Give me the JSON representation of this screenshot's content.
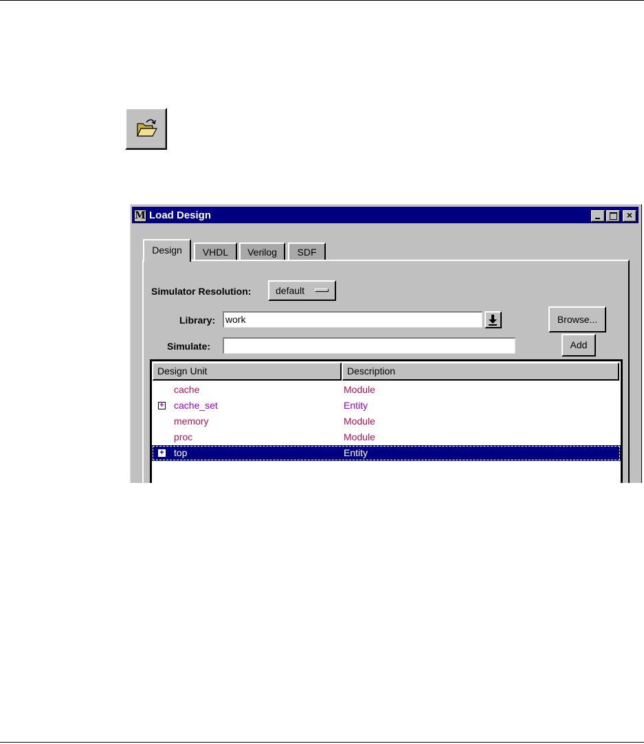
{
  "toolbar": {
    "open_icon": "open-folder-icon"
  },
  "dialog": {
    "title": "Load Design",
    "title_icon_letter": "M",
    "window_controls": [
      "minimize-icon",
      "maximize-icon",
      "close-icon"
    ],
    "tabs": [
      {
        "label": "Design",
        "active": true
      },
      {
        "label": "VHDL",
        "active": false
      },
      {
        "label": "Verilog",
        "active": false
      },
      {
        "label": "SDF",
        "active": false
      }
    ],
    "simulator_resolution": {
      "label": "Simulator Resolution:",
      "value": "default"
    },
    "library": {
      "label": "Library:",
      "value": "work"
    },
    "simulate": {
      "label": "Simulate:",
      "value": ""
    },
    "browse_label": "Browse...",
    "add_label": "Add",
    "list": {
      "columns": [
        "Design Unit",
        "Description"
      ],
      "rows": [
        {
          "name": "cache",
          "description": "Module",
          "expandable": false,
          "selected": false
        },
        {
          "name": "cache_set",
          "description": "Entity",
          "expandable": true,
          "selected": false
        },
        {
          "name": "memory",
          "description": "Module",
          "expandable": false,
          "selected": false
        },
        {
          "name": "proc",
          "description": "Module",
          "expandable": false,
          "selected": false
        },
        {
          "name": "top",
          "description": "Entity",
          "expandable": true,
          "selected": true
        }
      ]
    },
    "colors": {
      "titlebar": "#000080",
      "module_text": "#b0105a",
      "entity_text": "#9c00d0",
      "selection": "#000080"
    }
  }
}
